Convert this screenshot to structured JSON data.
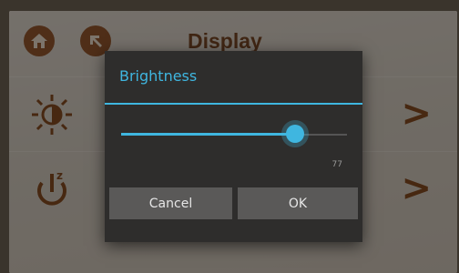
{
  "header": {
    "title": "Display"
  },
  "dialog": {
    "title": "Brightness",
    "slider": {
      "value_label": "77",
      "fraction": 0.77
    },
    "buttons": {
      "cancel": "Cancel",
      "ok": "OK"
    }
  },
  "icons": {
    "home": "home-icon",
    "back": "arrow-up-left-icon",
    "brightness": "brightness-icon",
    "sleep": "power-sleep-icon",
    "chevron": "chevron-right-icon"
  },
  "colors": {
    "accent": "#3fb6e0",
    "brand": "#7a3e12",
    "dialog_bg": "#2e2d2c",
    "button_bg": "#5a5958"
  }
}
